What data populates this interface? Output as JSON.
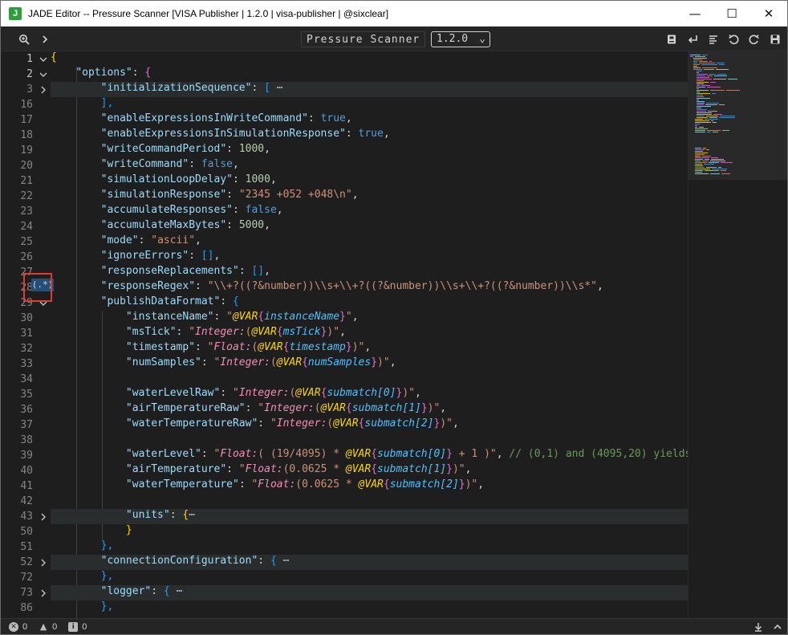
{
  "window": {
    "title": "JADE Editor -- Pressure Scanner [VISA Publisher | 1.2.0 | visa-publisher | @sixclear]",
    "logo_letter": "J",
    "minimize_glyph": "—",
    "maximize_glyph": "☐",
    "close_glyph": "✕"
  },
  "toolbar": {
    "title": "Pressure Scanner",
    "version": "1.2.0",
    "icons": [
      "zoom-icon",
      "expand-arrow-icon",
      "bookmark-icon",
      "word-wrap-icon",
      "format-icon",
      "undo-icon",
      "redo-icon",
      "save-icon"
    ]
  },
  "editor": {
    "regex_hint": "(.*)",
    "line_numbers": [
      "1",
      "2",
      "3",
      "16",
      "17",
      "18",
      "19",
      "20",
      "21",
      "22",
      "23",
      "24",
      "25",
      "26",
      "27",
      "28",
      "29",
      "30",
      "31",
      "32",
      "33",
      "34",
      "35",
      "36",
      "37",
      "38",
      "39",
      "40",
      "41",
      "42",
      "43",
      "50",
      "51",
      "52",
      "72",
      "73",
      "86"
    ],
    "code": {
      "l1": "{",
      "l2_key": "\"options\"",
      "l2_brace": "{",
      "l3_key": "\"initializationSequence\"",
      "l3_open": "[",
      "l3_dots": "⋯",
      "l16": "],",
      "l17_key": "\"enableExpressionsInWriteCommand\"",
      "l17_val": "true",
      "l18_key": "\"enableExpressionsInSimulationResponse\"",
      "l18_val": "true",
      "l19_key": "\"writeCommandPeriod\"",
      "l19_val": "1000",
      "l20_key": "\"writeCommand\"",
      "l20_val": "false",
      "l21_key": "\"simulationLoopDelay\"",
      "l21_val": "1000",
      "l22_key": "\"simulationResponse\"",
      "l22_val": "\"2345 +052 +048\\n\"",
      "l23_key": "\"accumulateResponses\"",
      "l23_val": "false",
      "l24_key": "\"accumulateMaxBytes\"",
      "l24_val": "5000",
      "l25_key": "\"mode\"",
      "l25_val": "\"ascii\"",
      "l26_key": "\"ignoreErrors\"",
      "l26_val": "[]",
      "l27_key": "\"responseReplacements\"",
      "l27_val": "[]",
      "l28_key": "\"responseRegex\"",
      "l28_val": "\"\\\\+?((?&number))\\\\s+\\\\+?((?&number))\\\\s+\\\\+?((?&number))\\\\s*\"",
      "l29_key": "\"publishDataFormat\"",
      "l29_brace": "{",
      "l30_key": "\"instanceName\"",
      "l30_var": "@VAR",
      "l30_name": "instanceName",
      "l31_key": "\"msTick\"",
      "l31_fn": "Integer",
      "l31_var": "@VAR",
      "l31_name": "msTick",
      "l32_key": "\"timestamp\"",
      "l32_fn": "Float",
      "l32_var": "@VAR",
      "l32_name": "timestamp",
      "l33_key": "\"numSamples\"",
      "l33_fn": "Integer",
      "l33_var": "@VAR",
      "l33_name": "numSamples",
      "l35_key": "\"waterLevelRaw\"",
      "l35_fn": "Integer",
      "l35_var": "@VAR",
      "l35_name": "submatch[0]",
      "l36_key": "\"airTemperatureRaw\"",
      "l36_fn": "Integer",
      "l36_var": "@VAR",
      "l36_name": "submatch[1]",
      "l37_key": "\"waterTemperatureRaw\"",
      "l37_fn": "Integer",
      "l37_var": "@VAR",
      "l37_name": "submatch[2]",
      "l39_key": "\"waterLevel\"",
      "l39_fn": "Float",
      "l39_pre": "( (19/4095) * ",
      "l39_var": "@VAR",
      "l39_name": "submatch[0]",
      "l39_post": " + 1 )",
      "l39_comment": "// (0,1) and (4095,20) yields",
      "l40_key": "\"airTemperature\"",
      "l40_fn": "Float",
      "l40_pre": "(0.0625 * ",
      "l40_var": "@VAR",
      "l40_name": "submatch[1]",
      "l41_key": "\"waterTemperature\"",
      "l41_fn": "Float",
      "l41_pre": "(0.0625 * ",
      "l41_var": "@VAR",
      "l41_name": "submatch[2]",
      "l43_key": "\"units\"",
      "l43_brace": "{",
      "l43_dots": "⋯",
      "l50": "}",
      "l51": "},",
      "l52_key": "\"connectionConfiguration\"",
      "l52_brace": "{",
      "l52_dots": "⋯",
      "l72": "},",
      "l73_key": "\"logger\"",
      "l73_brace": "{",
      "l73_dots": "⋯",
      "l86": "},"
    }
  },
  "statusbar": {
    "errors": "0",
    "warnings": "0",
    "info": "0"
  }
}
